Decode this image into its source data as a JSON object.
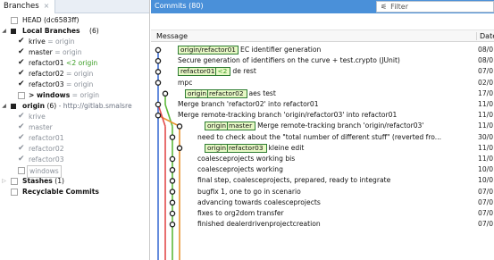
{
  "left_panel": {
    "tab": {
      "label": "Branches",
      "close": "×"
    },
    "tree": {
      "head": "HEAD (dc6583ff)",
      "local": {
        "title": "Local Branches",
        "count": "(6)"
      },
      "local_items": [
        {
          "name": "krive",
          "sep": " = ",
          "track": "origin",
          "track_class": "grey"
        },
        {
          "name": "master",
          "sep": " = ",
          "track": "origin",
          "track_class": "grey"
        },
        {
          "name": "refactor01",
          "sep": " ",
          "track": "<2 origin",
          "track_class": "green"
        },
        {
          "name": "refactor02",
          "sep": " = ",
          "track": "origin",
          "track_class": "grey"
        },
        {
          "name": "refactor03",
          "sep": " = ",
          "track": "origin",
          "track_class": "grey"
        },
        {
          "name": "> windows",
          "sep": " = ",
          "track": "origin",
          "track_class": "grey"
        }
      ],
      "origin": {
        "title": "origin",
        "count": "(6)",
        "url": " - http://gitlab.smalsre"
      },
      "origin_items": [
        "krive",
        "master",
        "refactor01",
        "refactor02",
        "refactor03",
        "windows"
      ],
      "stashes": {
        "title": "Stashes",
        "count": "(1)"
      },
      "recyclable": "Recyclable Commits"
    }
  },
  "right_panel": {
    "tab_label": "Commits (80)",
    "filter": {
      "icon": "filter-icon",
      "placeholder": "Filter"
    },
    "columns": {
      "message": "Message",
      "date": "Date"
    },
    "commits": [
      {
        "refs": [
          {
            "lead": "origin/refactor01",
            "inner": ""
          }
        ],
        "message": "EC identifier generation",
        "date": "08/0"
      },
      {
        "refs": [],
        "message": "Secure generation of identifiers on the curve + test.crypto (JUnit)",
        "date": "08/0"
      },
      {
        "refs": [
          {
            "lead": "refactor01",
            "inner": "<2"
          }
        ],
        "message": "de rest",
        "date": "07/0"
      },
      {
        "refs": [],
        "message": "mpc",
        "date": "02/0"
      },
      {
        "refs": [
          {
            "lead": "origin",
            "inner": "refactor02"
          }
        ],
        "message": "aes test",
        "date": "17/0"
      },
      {
        "refs": [],
        "message": "Merge branch 'refactor02' into refactor01",
        "date": "11/0"
      },
      {
        "refs": [],
        "message": "Merge remote-tracking branch 'origin/refactor03' into refactor01",
        "date": "11/0"
      },
      {
        "refs": [
          {
            "lead": "origin",
            "inner": "master"
          }
        ],
        "message": "Merge remote-tracking branch 'origin/refactor03'",
        "date": "11/0"
      },
      {
        "refs": [],
        "message": "need to check about the \"total number of different stuff\" (reverted fro...",
        "date": "30/0"
      },
      {
        "refs": [
          {
            "lead": "origin",
            "inner": "refactor03"
          }
        ],
        "message": "kleine edit",
        "date": "11/0"
      },
      {
        "refs": [],
        "message": "coalesceprojects working bis",
        "date": "11/0"
      },
      {
        "refs": [],
        "message": "coalesceprojects working",
        "date": "10/0"
      },
      {
        "refs": [],
        "message": "final step, coalesceprojects, prepared, ready to integrate",
        "date": "10/0"
      },
      {
        "refs": [],
        "message": "bugfix 1, one to go in scenario",
        "date": "07/0"
      },
      {
        "refs": [],
        "message": "advancing towards coalesceprojects",
        "date": "07/0"
      },
      {
        "refs": [],
        "message": "fixes to org2dom transfer",
        "date": "07/0"
      },
      {
        "refs": [],
        "message": "finished dealerdrivenprojectcreation",
        "date": "07/0"
      }
    ],
    "graph_colors": {
      "blue": "#3f6fd4",
      "green": "#5db93a",
      "orange": "#e8922f",
      "red": "#e34b4b",
      "node": "#1a1a1a"
    }
  }
}
